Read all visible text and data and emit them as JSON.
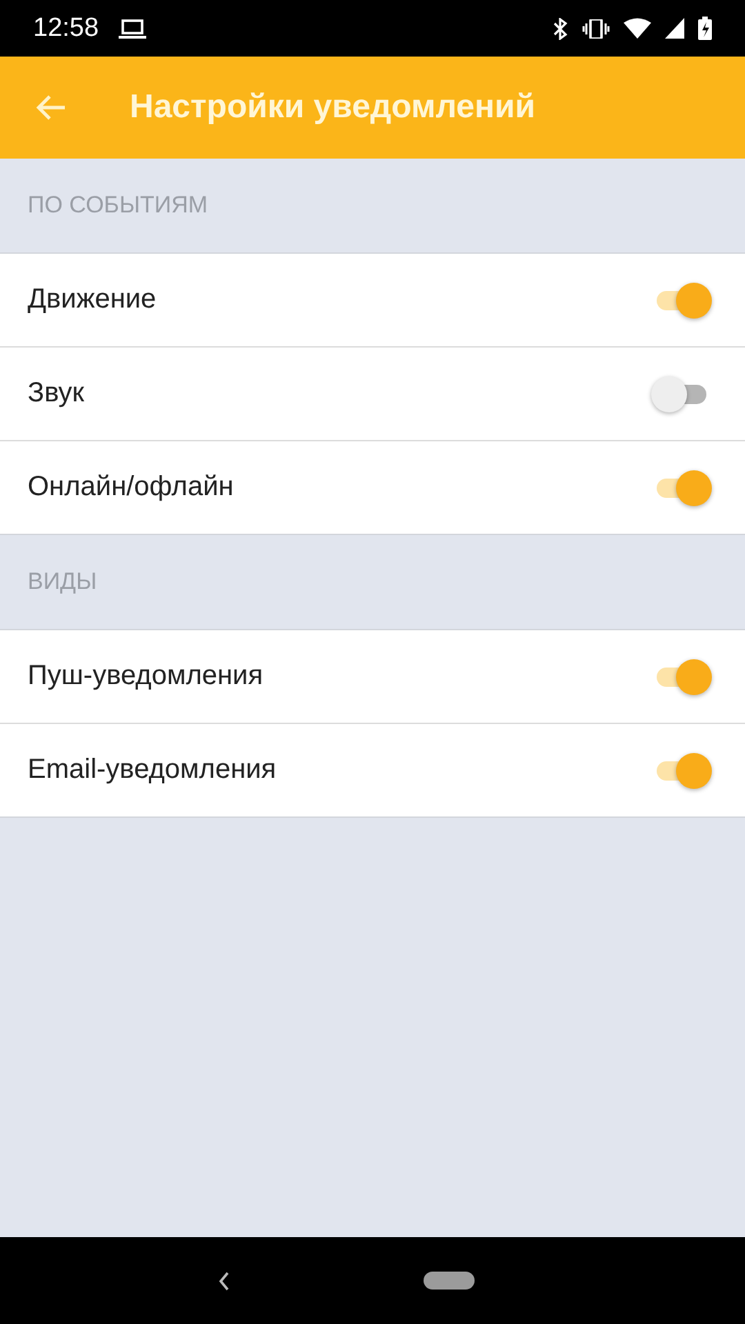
{
  "status_bar": {
    "time": "12:58"
  },
  "app_bar": {
    "title": "Настройки уведомлений"
  },
  "sections": [
    {
      "title": "ПО СОБЫТИЯМ",
      "items": [
        {
          "label": "Движение",
          "on": true
        },
        {
          "label": "Звук",
          "on": false
        },
        {
          "label": "Онлайн/офлайн",
          "on": true
        }
      ]
    },
    {
      "title": "ВИДЫ",
      "items": [
        {
          "label": "Пуш-уведомления",
          "on": true
        },
        {
          "label": "Email-уведомления",
          "on": true
        }
      ]
    }
  ]
}
